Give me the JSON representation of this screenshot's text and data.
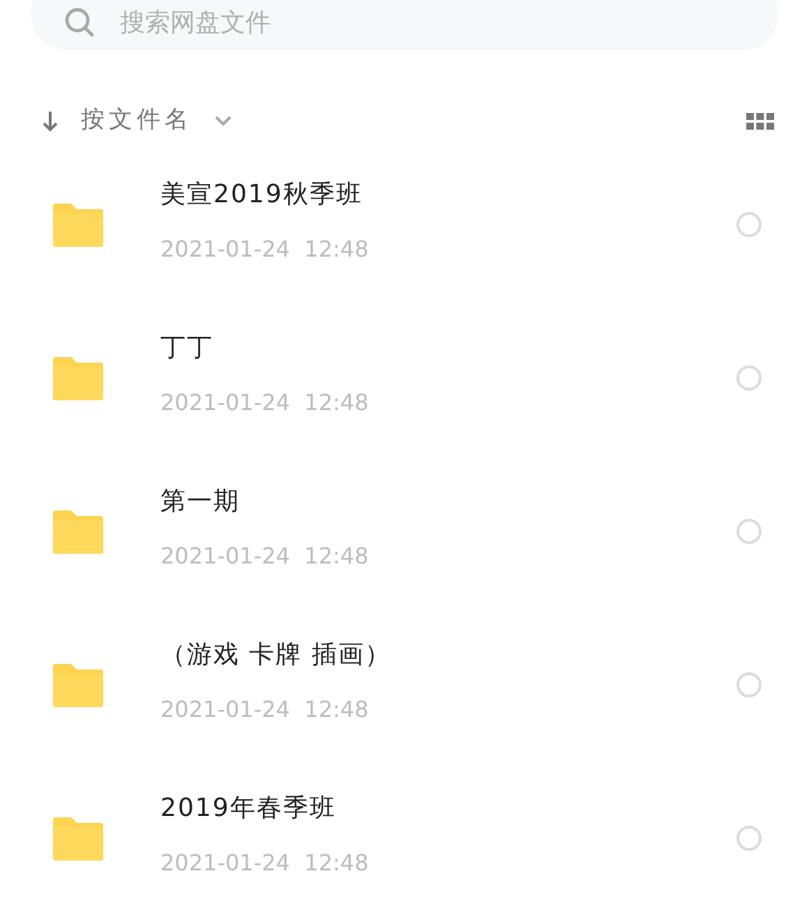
{
  "search": {
    "placeholder": "搜索网盘文件"
  },
  "sort": {
    "label": "按文件名"
  },
  "files": [
    {
      "kind": "folder",
      "name": "美宣2019秋季班",
      "date": "2021-01-24  12:48",
      "selected": false
    },
    {
      "kind": "folder",
      "name": "丁丁",
      "date": "2021-01-24  12:48",
      "selected": false
    },
    {
      "kind": "folder",
      "name": "第一期",
      "date": "2021-01-24  12:48",
      "selected": false
    },
    {
      "kind": "folder",
      "name": "（游戏 卡牌 插画）",
      "date": "2021-01-24  12:48",
      "selected": false
    },
    {
      "kind": "folder",
      "name": "2019年春季班",
      "date": "2021-01-24  12:48",
      "selected": false
    }
  ]
}
